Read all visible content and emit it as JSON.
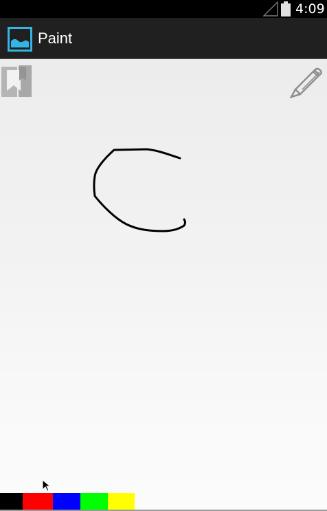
{
  "status_bar": {
    "time": "4:09",
    "signal_icon": "signal-icon",
    "battery_icon": "battery-icon"
  },
  "action_bar": {
    "title": "Paint",
    "icon": "image-icon",
    "icon_color": "#33b5e5"
  },
  "toolbar": {
    "left_tool_icon": "bookmark-icon",
    "right_tool_icon": "pencil-icon"
  },
  "canvas": {
    "stroke_color": "#000000",
    "cursor_icon": "mouse-pointer-icon"
  },
  "palette": {
    "colors": [
      {
        "name": "black",
        "hex": "#000000"
      },
      {
        "name": "red",
        "hex": "#ff0000"
      },
      {
        "name": "blue",
        "hex": "#0000ff"
      },
      {
        "name": "green",
        "hex": "#00ff00"
      },
      {
        "name": "yellow",
        "hex": "#ffff00"
      }
    ]
  }
}
